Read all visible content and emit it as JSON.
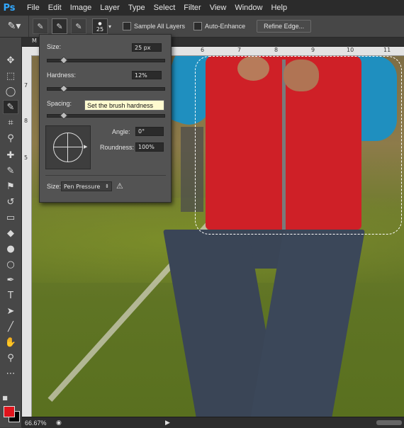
{
  "app": {
    "logo": "Ps"
  },
  "menu": [
    "File",
    "Edit",
    "Image",
    "Layer",
    "Type",
    "Select",
    "Filter",
    "View",
    "Window",
    "Help"
  ],
  "options": {
    "brush_size": "25",
    "sample_all_layers": "Sample All Layers",
    "auto_enhance": "Auto-Enhance",
    "refine_edge": "Refine Edge..."
  },
  "tab": {
    "label": "M"
  },
  "rulers": {
    "top": [
      "6",
      "7",
      "8",
      "9",
      "10",
      "11"
    ],
    "left": [
      "7",
      "8",
      "5"
    ]
  },
  "brush_panel": {
    "size_label": "Size:",
    "size_value": "25 px",
    "size_level": 0.12,
    "hardness_label": "Hardness:",
    "hardness_value": "12%",
    "hardness_level": 0.12,
    "spacing_label": "Spacing:",
    "spacing_level": 0.12,
    "tooltip": "Set the brush hardness",
    "angle_label": "Angle:",
    "angle_value": "0°",
    "roundness_label": "Roundness:",
    "roundness_value": "100%",
    "size_control_label": "Size:",
    "size_control_value": "Pen Pressure",
    "warning_icon": "⚠"
  },
  "status": {
    "zoom": "66.67%"
  },
  "colors": {
    "foreground": "#e0141c",
    "background": "#000000"
  }
}
